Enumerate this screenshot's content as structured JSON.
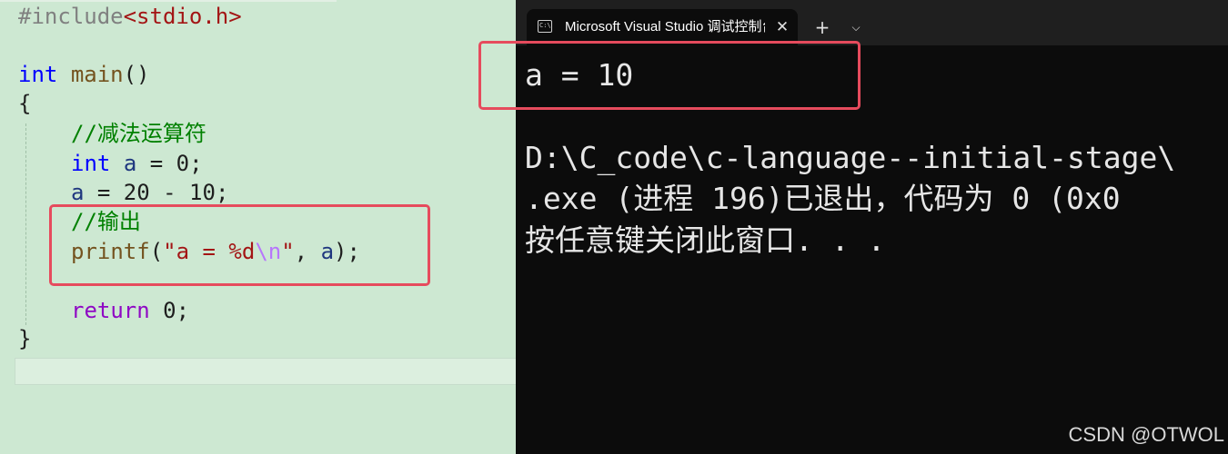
{
  "editor": {
    "lines": {
      "include_directive": "#include",
      "include_header": "<stdio.h>",
      "int_kw": "int",
      "main_fn": "main",
      "main_parens": "()",
      "open_brace": "{",
      "comment_subtract": "//减法运算符",
      "decl_type": "int",
      "decl_var": "a",
      "decl_rest": " = 0;",
      "assign_var": "a",
      "assign_rest": " = 20 - 10;",
      "comment_output": "//输出",
      "printf_fn": "printf",
      "printf_open": "(",
      "printf_str_start": "\"a = %d",
      "printf_escape": "\\n",
      "printf_str_end": "\"",
      "printf_comma": ", ",
      "printf_arg": "a",
      "printf_close": ");",
      "return_kw": "return",
      "return_rest": " 0;",
      "close_brace": "}"
    }
  },
  "terminal": {
    "tab_title": "Microsoft Visual Studio 调试控制台",
    "tab_close": "✕",
    "new_tab": "+",
    "dropdown": "⌵",
    "output_line": "a = 10",
    "exit_line1": "D:\\C_code\\c-language--initial-stage\\",
    "exit_line2": ".exe (进程 196)已退出，代码为 0 (0x0",
    "exit_line3": "按任意键关闭此窗口. . ."
  },
  "watermark": "CSDN @OTWOL",
  "colors": {
    "editor_bg": "#cde8d2",
    "terminal_bg": "#0c0c0c",
    "highlight_box": "#e64b5d"
  }
}
